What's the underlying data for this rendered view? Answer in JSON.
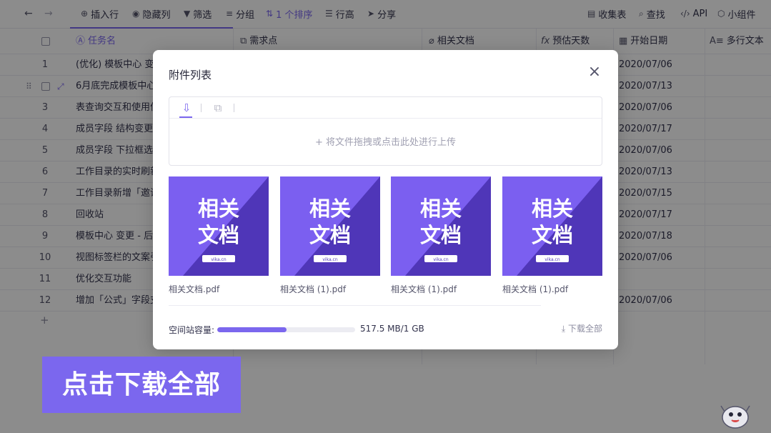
{
  "toolbar": {
    "insert_row": "插入行",
    "hide_column": "隐藏列",
    "filter": "筛选",
    "group": "分组",
    "sort": "1 个排序",
    "row_height": "行高",
    "share": "分享",
    "form": "收集表",
    "search": "查找",
    "api": "API",
    "widget": "小组件",
    "icons": [
      "undo-icon",
      "redo-icon",
      "plus-circle-icon",
      "eye-icon",
      "filter-icon",
      "list-icon",
      "sort-icon",
      "row-height-icon",
      "share-icon",
      "form-icon",
      "search-icon",
      "code-icon",
      "cube-icon"
    ]
  },
  "grid": {
    "columns": {
      "task_name": "任务名",
      "requirement": "需求点",
      "related_doc": "相关文档",
      "estimate_days": "预估天数",
      "start_date": "开始日期",
      "multiline_text": "多行文本"
    },
    "rows": [
      {
        "index": "1",
        "name": "(优化) 模板中心 变更",
        "date": "2020/07/06"
      },
      {
        "index": "",
        "name": "6月底完成模板中心",
        "date": "2020/07/13"
      },
      {
        "index": "3",
        "name": "表查询交互和使用优",
        "date": "2020/07/06"
      },
      {
        "index": "4",
        "name": "成员字段 结构变更",
        "date": "2020/07/17"
      },
      {
        "index": "5",
        "name": "成员字段 下拉框选项",
        "date": "2020/07/06"
      },
      {
        "index": "6",
        "name": "工作目录的实时刷新",
        "date": "2020/07/13"
      },
      {
        "index": "7",
        "name": "工作目录新增「邀请",
        "date": "2020/07/15"
      },
      {
        "index": "8",
        "name": "回收站",
        "date": "2020/07/17"
      },
      {
        "index": "9",
        "name": "模板中心 变更 - 后端",
        "date": "2020/07/18"
      },
      {
        "index": "10",
        "name": "视图标签栏的文案引",
        "date": "2020/07/06"
      },
      {
        "index": "11",
        "name": "优化交互功能",
        "date": ""
      },
      {
        "index": "12",
        "name": "增加「公式」字段支",
        "date": "2020/07/06"
      }
    ],
    "add_row": "+"
  },
  "dialog": {
    "title": "附件列表",
    "close": "×",
    "upload_hint": "+ 将文件拖拽或点击此处进行上传",
    "files": [
      {
        "name": "相关文档.pdf",
        "thumb_line1": "相关",
        "thumb_line2": "文档",
        "thumb_badge": "vika.cn"
      },
      {
        "name": "相关文档 (1).pdf",
        "thumb_line1": "相关",
        "thumb_line2": "文档",
        "thumb_badge": "vika.cn"
      },
      {
        "name": "相关文档 (1).pdf",
        "thumb_line1": "相关",
        "thumb_line2": "文档",
        "thumb_badge": "vika.cn"
      },
      {
        "name": "相关文档 (1).pdf",
        "thumb_line1": "相关",
        "thumb_line2": "文档",
        "thumb_badge": "vika.cn"
      }
    ],
    "capacity_label": "空间站容量:",
    "capacity_text": "517.5 MB/1 GB",
    "capacity_fraction": 0.505,
    "download_all": "下载全部"
  },
  "callout": "点击下载全部",
  "colors": {
    "accent": "#7b67ee",
    "thumb_light": "#7b5ff0",
    "thumb_dark": "#4f36b8"
  }
}
